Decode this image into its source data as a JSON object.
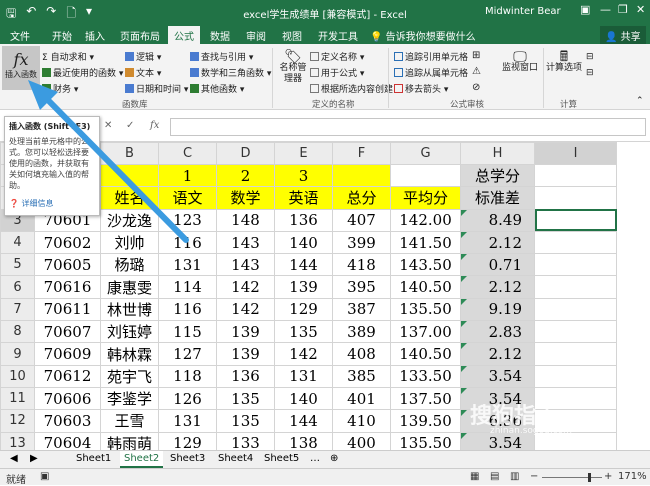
{
  "window": {
    "title": "excel学生成绩单 [兼容模式] - Excel",
    "user": "Midwinter Bear",
    "share": "共享"
  },
  "tabs": [
    "文件",
    "开始",
    "插入",
    "页面布局",
    "公式",
    "数据",
    "审阅",
    "视图",
    "开发工具",
    "告诉我你想要做什么"
  ],
  "active_tab": "公式",
  "ribbon": {
    "insert_function": "插入函数",
    "fx_symbol": "fx",
    "library": {
      "autosum": "自动求和",
      "recent": "最近使用的函数",
      "financial": "财务",
      "logical": "逻辑",
      "text": "文本",
      "datetime": "日期和时间",
      "lookup": "查找与引用",
      "math": "数学和三角函数",
      "more": "其他函数",
      "group_label": "函数库"
    },
    "names": {
      "manager": "名称管理器",
      "define": "定义名称",
      "use_in_formula": "用于公式",
      "create": "根据所选内容创建",
      "group_label": "定义的名称"
    },
    "audit": {
      "trace_prec": "追踪引用单元格",
      "trace_dep": "追踪从属单元格",
      "remove_arrows": "移去箭头",
      "watch": "监视窗口",
      "group_label": "公式审核"
    },
    "calc": {
      "options": "计算选项",
      "group_label": "计算"
    }
  },
  "tooltip": {
    "title": "插入函数 (Shift+F3)",
    "body": "处理当前单元格中的公式。您可以轻松选择要使用的函数，并获取有关如何填充输入值的帮助。",
    "more": "详细信息"
  },
  "formula_bar": {
    "cancel": "✕",
    "enter": "✓",
    "fx": "fx",
    "value": ""
  },
  "columns": [
    "",
    "A",
    "B",
    "C",
    "D",
    "E",
    "F",
    "G",
    "H",
    "I"
  ],
  "rows": [
    {
      "n": "1",
      "cells": [
        "",
        "",
        "1",
        "2",
        "3",
        "",
        "",
        "总学分",
        ""
      ]
    },
    {
      "n": "2",
      "cells": [
        "",
        "姓名",
        "语文",
        "数学",
        "英语",
        "总分",
        "平均分",
        "标准差",
        ""
      ]
    },
    {
      "n": "3",
      "cells": [
        "70601",
        "沙龙逸",
        "123",
        "148",
        "136",
        "407",
        "142.00",
        "8.49",
        ""
      ]
    },
    {
      "n": "4",
      "cells": [
        "70602",
        "刘帅",
        "116",
        "143",
        "140",
        "399",
        "141.50",
        "2.12",
        ""
      ]
    },
    {
      "n": "5",
      "cells": [
        "70605",
        "杨璐",
        "131",
        "143",
        "144",
        "418",
        "143.50",
        "0.71",
        ""
      ]
    },
    {
      "n": "6",
      "cells": [
        "70616",
        "康惠雯",
        "114",
        "142",
        "139",
        "395",
        "140.50",
        "2.12",
        ""
      ]
    },
    {
      "n": "7",
      "cells": [
        "70611",
        "林世博",
        "116",
        "142",
        "129",
        "387",
        "135.50",
        "9.19",
        ""
      ]
    },
    {
      "n": "8",
      "cells": [
        "70607",
        "刘钰婷",
        "115",
        "139",
        "135",
        "389",
        "137.00",
        "2.83",
        ""
      ]
    },
    {
      "n": "9",
      "cells": [
        "70609",
        "韩林霖",
        "127",
        "139",
        "142",
        "408",
        "140.50",
        "2.12",
        ""
      ]
    },
    {
      "n": "10",
      "cells": [
        "70612",
        "苑宇飞",
        "118",
        "136",
        "131",
        "385",
        "133.50",
        "3.54",
        ""
      ]
    },
    {
      "n": "11",
      "cells": [
        "70606",
        "李鉴学",
        "126",
        "135",
        "140",
        "401",
        "137.50",
        "3.54",
        ""
      ]
    },
    {
      "n": "12",
      "cells": [
        "70603",
        "王雪",
        "131",
        "135",
        "144",
        "410",
        "139.50",
        "6.36",
        ""
      ]
    },
    {
      "n": "13",
      "cells": [
        "70604",
        "韩雨萌",
        "129",
        "133",
        "138",
        "400",
        "135.50",
        "3.54",
        ""
      ]
    }
  ],
  "sheets": [
    "Sheet1",
    "Sheet2",
    "Sheet3",
    "Sheet4",
    "Sheet5"
  ],
  "active_sheet": "Sheet2",
  "status": {
    "ready": "就绪",
    "zoom": "171%"
  },
  "watermark": {
    "main": "搜狗指南",
    "sub": "zhinan.sogou.com"
  },
  "colors": {
    "excel_green": "#217346",
    "highlight_yellow": "#ffff00",
    "arrow_blue": "#3b9be0"
  }
}
